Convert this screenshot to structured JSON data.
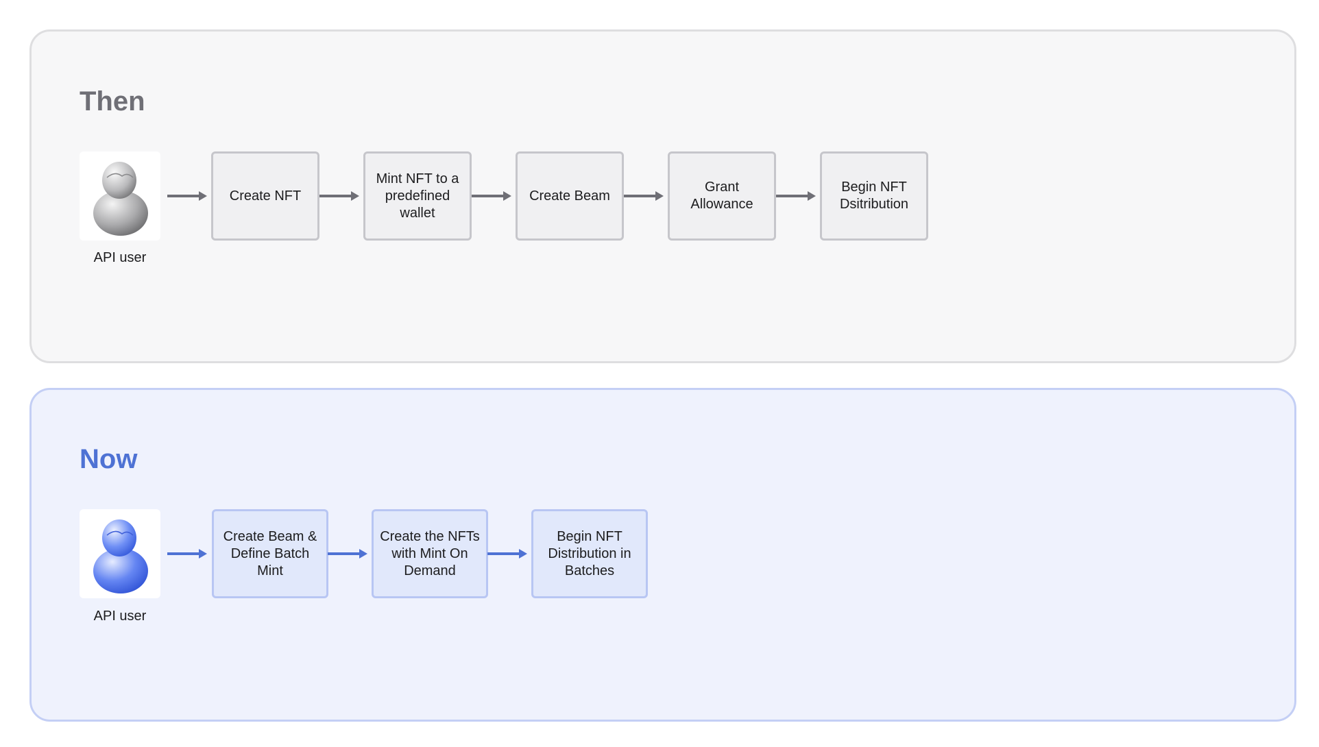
{
  "colors": {
    "then_accent": "#6f6f76",
    "now_accent": "#4e72d4",
    "then_panel": "#f7f7f8",
    "now_panel": "#eff2fd"
  },
  "then": {
    "title": "Then",
    "user_label": "API user",
    "avatar_icon": "user-avatar-grey",
    "steps": [
      "Create NFT",
      "Mint NFT to a predefined wallet",
      "Create Beam",
      "Grant Allowance",
      "Begin NFT Dsitribution"
    ]
  },
  "now": {
    "title": "Now",
    "user_label": "API user",
    "avatar_icon": "user-avatar-blue",
    "steps": [
      "Create Beam & Define Batch Mint",
      "Create the NFTs with Mint On Demand",
      "Begin NFT Distribution in Batches"
    ]
  }
}
